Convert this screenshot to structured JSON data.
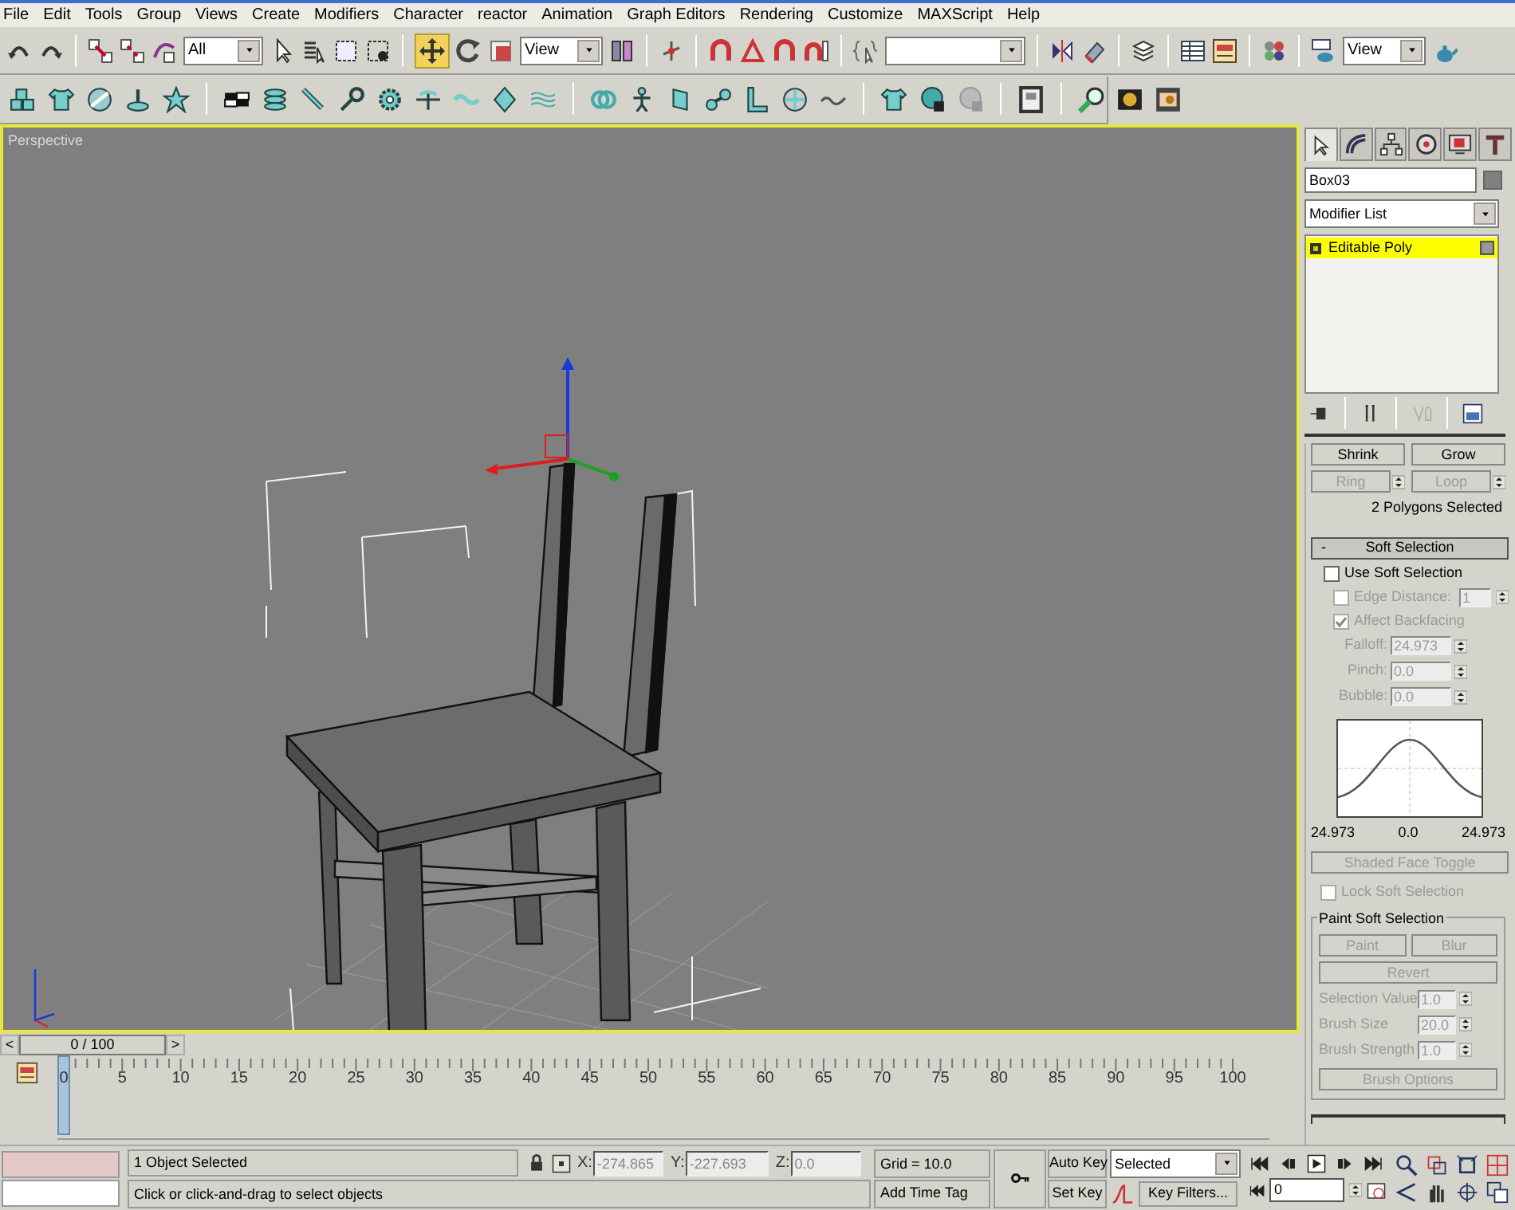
{
  "menu": [
    {
      "label": "File"
    },
    {
      "label": "Edit"
    },
    {
      "label": "Tools"
    },
    {
      "label": "Group"
    },
    {
      "label": "Views"
    },
    {
      "label": "Create"
    },
    {
      "label": "Modifiers"
    },
    {
      "label": "Character"
    },
    {
      "label": "reactor"
    },
    {
      "label": "Animation"
    },
    {
      "label": "Graph Editors"
    },
    {
      "label": "Rendering"
    },
    {
      "label": "Customize"
    },
    {
      "label": "MAXScript"
    },
    {
      "label": "Help"
    }
  ],
  "toolbar": {
    "selection_filter": "All",
    "reference_coordinate": "View",
    "render_view": "View"
  },
  "viewport": {
    "label": "Perspective",
    "active": true
  },
  "command_panel": {
    "tabs": [
      {
        "selected": true
      },
      {
        "selected": false
      },
      {
        "selected": false
      },
      {
        "selected": false
      },
      {
        "selected": false
      },
      {
        "selected": false
      }
    ],
    "object_name": "Box03",
    "modifier_list": "Modifier List",
    "stack": [
      {
        "label": "Editable Poly",
        "selected": true
      }
    ]
  },
  "selection_rollout": {
    "buttons": [
      {
        "label": "Shrink",
        "disabled": false,
        "spinner": false
      },
      {
        "label": "Grow",
        "disabled": false,
        "spinner": false
      },
      {
        "label": "Ring",
        "disabled": true,
        "spinner": true
      },
      {
        "label": "Loop",
        "disabled": true,
        "spinner": true
      }
    ],
    "status": "2 Polygons Selected"
  },
  "soft_selection": {
    "collapse": "-",
    "title": "Soft Selection",
    "checks": [
      {
        "label": "Use Soft Selection",
        "checked": false,
        "disabled": false
      },
      {
        "label": "Edge Distance:",
        "checked": false,
        "disabled": true,
        "value": "1"
      },
      {
        "label": "Affect Backfacing",
        "checked": true,
        "disabled": true
      }
    ],
    "params": [
      {
        "label": "Falloff:",
        "value": "24.973",
        "disabled": true
      },
      {
        "label": "Pinch:",
        "value": "0.0",
        "disabled": true
      },
      {
        "label": "Bubble:",
        "value": "0.0",
        "disabled": true
      }
    ],
    "curve_labels": [
      "24.973",
      "0.0",
      "24.973"
    ],
    "shaded_face_toggle": {
      "label": "Shaded Face Toggle",
      "disabled": true
    },
    "lock": {
      "label": "Lock Soft Selection",
      "checked": false,
      "disabled": true
    },
    "paint_group": {
      "title": "Paint Soft Selection",
      "buttons": [
        {
          "label": "Paint",
          "disabled": true
        },
        {
          "label": "Blur",
          "disabled": true
        }
      ],
      "revert": {
        "label": "Revert",
        "disabled": true
      },
      "params": [
        {
          "label": "Selection Value",
          "value": "1.0",
          "disabled": true
        },
        {
          "label": "Brush Size",
          "value": "20.0",
          "disabled": true
        },
        {
          "label": "Brush Strength",
          "value": "1.0",
          "disabled": true
        }
      ],
      "brush_options": {
        "label": "Brush Options",
        "disabled": true
      }
    }
  },
  "timeline": {
    "prev": "<",
    "slider": "0 / 100",
    "next": ">",
    "ticks": [
      "0",
      "5",
      "10",
      "15",
      "20",
      "25",
      "30",
      "35",
      "40",
      "45",
      "50",
      "55",
      "60",
      "65",
      "70",
      "75",
      "80",
      "85",
      "90",
      "95",
      "100"
    ]
  },
  "status": {
    "selection": "1 Object Selected",
    "prompt": "Click or click-and-drag to select objects",
    "coords": [
      {
        "label": "X:",
        "value": "-274.865"
      },
      {
        "label": "Y:",
        "value": "-227.693"
      },
      {
        "label": "Z:",
        "value": "0.0"
      }
    ],
    "grid": "Grid = 10.0",
    "add_time_tag": "Add Time Tag",
    "auto_key": "Auto Key",
    "set_key": "Set Key",
    "key_mode": "Selected",
    "key_filters": "Key Filters...",
    "frame": "0"
  }
}
